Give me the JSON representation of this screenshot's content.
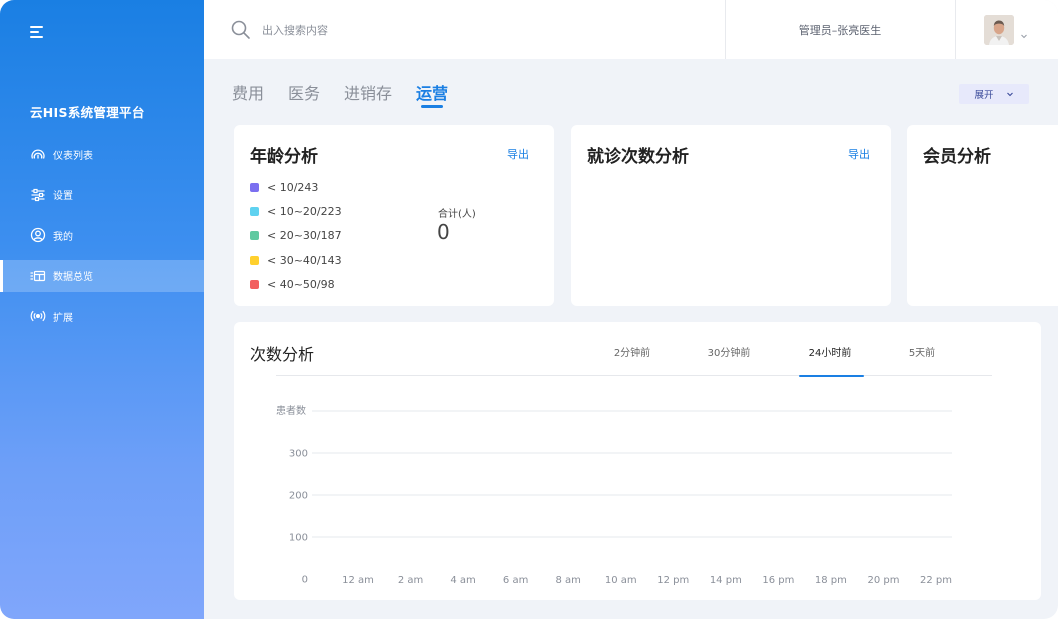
{
  "app": {
    "title": "云HIS系统管理平台"
  },
  "sidebar": {
    "items": [
      {
        "label": "仪表列表",
        "icon": "dashboard-icon",
        "active": false
      },
      {
        "label": "设置",
        "icon": "sliders-icon",
        "active": false
      },
      {
        "label": "我的",
        "icon": "user-icon",
        "active": false
      },
      {
        "label": "数据总览",
        "icon": "data-overview-icon",
        "active": true
      },
      {
        "label": "扩展",
        "icon": "broadcast-icon",
        "active": false
      }
    ]
  },
  "header": {
    "search_placeholder": "出入搜索内容",
    "admin": "管理员–张亮医生"
  },
  "tabs": [
    {
      "label": "费用",
      "active": false
    },
    {
      "label": "医务",
      "active": false
    },
    {
      "label": "进销存",
      "active": false
    },
    {
      "label": "运营",
      "active": true
    }
  ],
  "expand_button": "展开",
  "cards": {
    "age": {
      "title": "年龄分析",
      "export": "导出",
      "legend": [
        {
          "label": "< 10/243",
          "color": "#7b6ff0"
        },
        {
          "label": "< 10~20/223",
          "color": "#5fd2f0"
        },
        {
          "label": "< 20~30/187",
          "color": "#5ec9a0"
        },
        {
          "label": "< 30~40/143",
          "color": "#ffd02e"
        },
        {
          "label": "< 40~50/98",
          "color": "#f25e5e"
        }
      ],
      "total_label": "合计(人)",
      "total_value": "0"
    },
    "visits": {
      "title": "就诊次数分析",
      "export": "导出"
    },
    "members": {
      "title": "会员分析"
    },
    "count": {
      "title": "次数分析",
      "time_tabs": [
        {
          "label": "2分钟前",
          "active": false
        },
        {
          "label": "30分钟前",
          "active": false
        },
        {
          "label": "24小时前",
          "active": true
        },
        {
          "label": "5天前",
          "active": false
        }
      ]
    }
  },
  "chart_data": {
    "type": "line",
    "title": "",
    "ylabel": "患者数",
    "xlabel": "",
    "ylim": [
      0,
      400
    ],
    "y_ticks": [
      0,
      100,
      200,
      300
    ],
    "y_tick_labels": [
      "0",
      "100",
      "200",
      "300"
    ],
    "categories": [
      "12 am",
      "2 am",
      "4 am",
      "6 am",
      "8 am",
      "10 am",
      "12 pm",
      "14 pm",
      "16 pm",
      "18 pm",
      "20 pm",
      "22 pm"
    ],
    "series": [],
    "grid": true,
    "legend": "none"
  },
  "colors": {
    "accent": "#1a7fe3",
    "sidebar_top": "#1a7fe3",
    "sidebar_bottom": "#80a6fb"
  }
}
